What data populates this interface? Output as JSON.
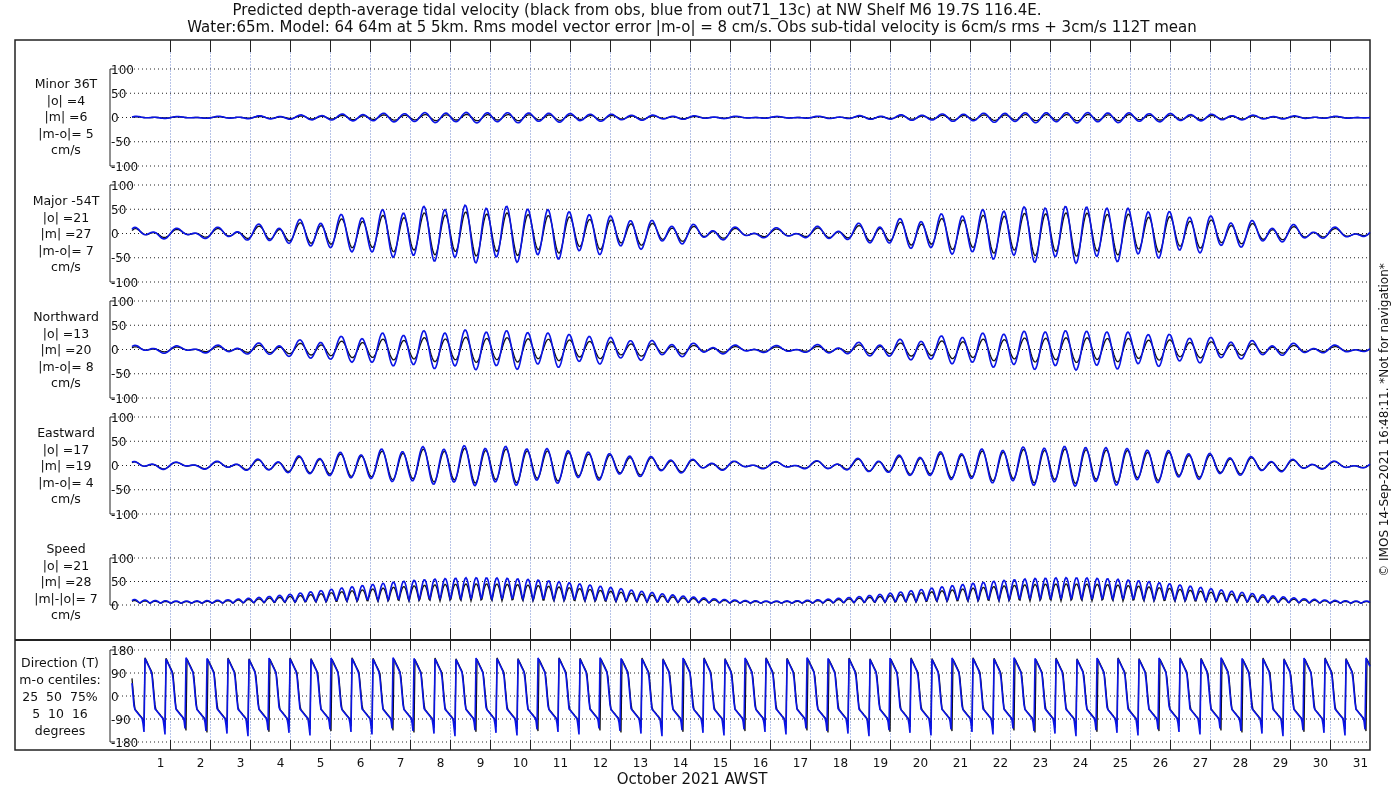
{
  "title": [
    "Predicted depth-average tidal velocity (black from obs, blue from out71_13c) at NW Shelf M6 19.7S 116.4E.",
    "Water:65m. Model: 64 64m at 5 5km. Rms model vector error |m-o| = 8 cm/s. Obs sub-tidal velocity is 6cm/s rms + 3cm/s 112T mean"
  ],
  "panels": [
    {
      "kind": "velocity",
      "label": [
        "Minor 36T",
        "|o| =4",
        "|m| =6",
        "|m-o|= 5",
        "cm/s"
      ],
      "yticks": [
        "100",
        "50",
        "0",
        "-50",
        "-100"
      ]
    },
    {
      "kind": "velocity",
      "label": [
        "Major -54T",
        "|o| =21",
        "|m| =27",
        "|m-o|= 7",
        "cm/s"
      ],
      "yticks": [
        "100",
        "50",
        "0",
        "-50",
        "-100"
      ]
    },
    {
      "kind": "velocity",
      "label": [
        "Northward",
        "|o| =13",
        "|m| =20",
        "|m-o|= 8",
        "cm/s"
      ],
      "yticks": [
        "100",
        "50",
        "0",
        "-50",
        "-100"
      ]
    },
    {
      "kind": "velocity",
      "label": [
        "Eastward",
        "|o| =17",
        "|m| =19",
        "|m-o|= 4",
        "cm/s"
      ],
      "yticks": [
        "100",
        "50",
        "0",
        "-50",
        "-100"
      ]
    },
    {
      "kind": "speed",
      "label": [
        "Speed",
        "|o| =21",
        "|m| =28",
        "|m|-|o|= 7",
        "cm/s"
      ],
      "yticks": [
        "100",
        "50",
        "0"
      ]
    },
    {
      "kind": "direction",
      "label": [
        "Direction (T)",
        "m-o centiles:",
        "25  50  75%",
        "5  10  16",
        "degrees"
      ],
      "yticks": [
        "180",
        "90",
        "0",
        "-90",
        "-180"
      ]
    }
  ],
  "xticks": [
    "1",
    "2",
    "3",
    "4",
    "5",
    "6",
    "7",
    "8",
    "9",
    "10",
    "11",
    "12",
    "13",
    "14",
    "15",
    "16",
    "17",
    "18",
    "19",
    "20",
    "21",
    "22",
    "23",
    "24",
    "25",
    "26",
    "27",
    "28",
    "29",
    "30",
    "31"
  ],
  "xlabel": "October 2021 AWST",
  "footer_note": "© IMOS 14-Sep-2021 16:48:11. *Not for navigation*"
}
